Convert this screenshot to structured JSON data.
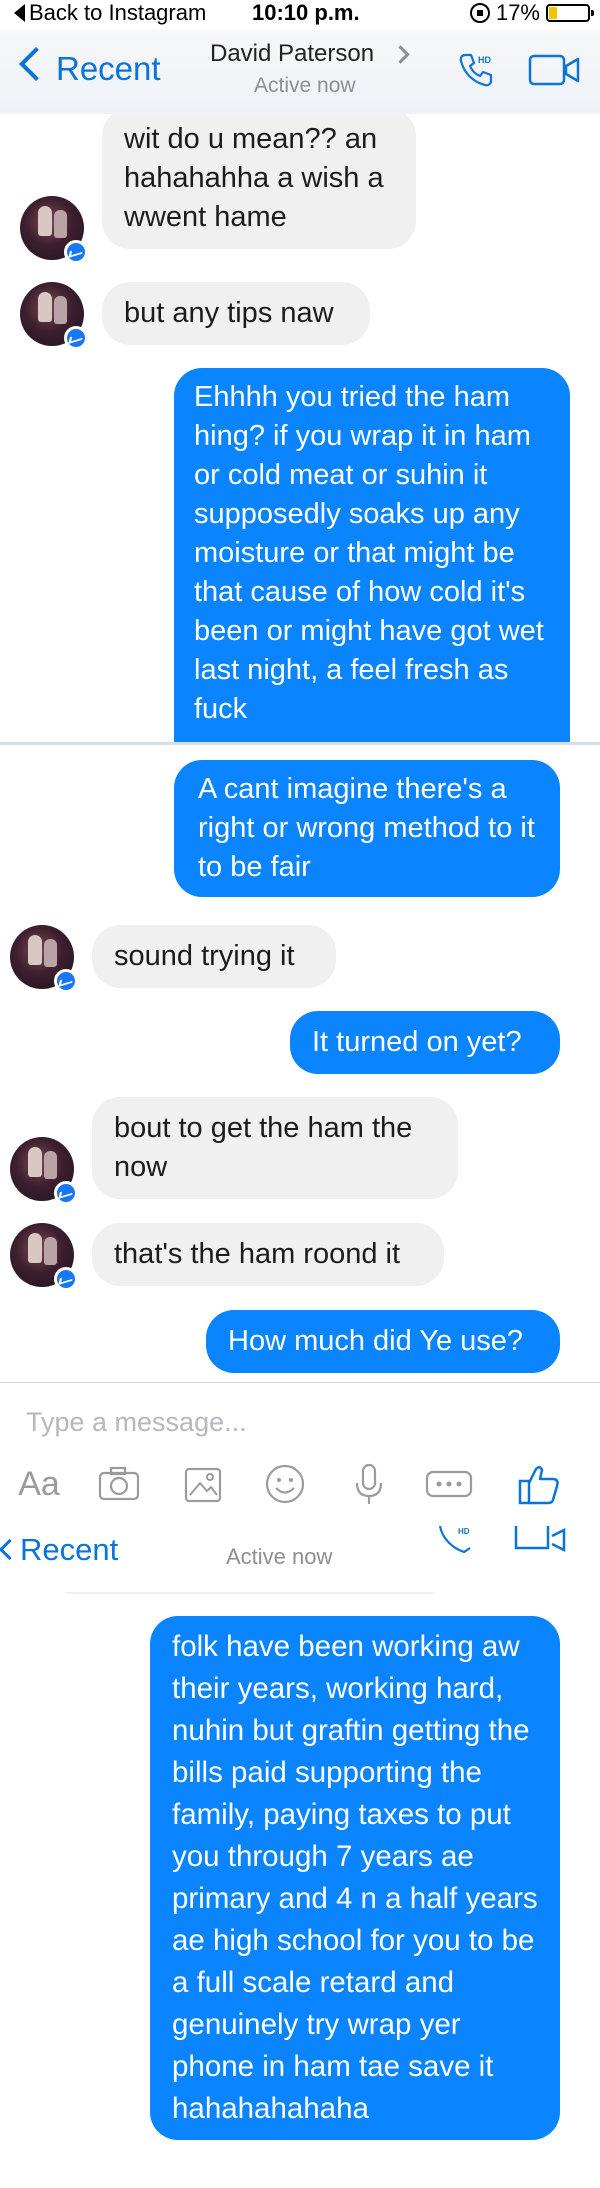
{
  "status_bar": {
    "back_label": "Back to Instagram",
    "time": "10:10 p.m.",
    "battery": "17%",
    "battery_level": 0.17
  },
  "nav": {
    "back_label": "Recent",
    "contact_name": "David Paterson",
    "status": "Active now"
  },
  "messages": [
    {
      "from": "them",
      "text": "wit do u mean?? an hahahahha a wish a wwent hame"
    },
    {
      "from": "them",
      "text": "but any tips naw"
    },
    {
      "from": "me",
      "text": "Ehhhh you tried the ham hing? if you wrap it in ham or cold meat or suhin it supposedly soaks up any moisture or that might be that cause of how cold it's been or might have got wet last night, a feel fresh as fuck"
    },
    {
      "from": "me",
      "text": "A cant imagine there's a right or wrong method to it to be fair"
    },
    {
      "from": "them",
      "text": "sound trying it"
    },
    {
      "from": "me",
      "text": "It turned on yet?"
    },
    {
      "from": "them",
      "text": "bout to get the ham the now"
    },
    {
      "from": "them",
      "text": "that's the ham roond it"
    },
    {
      "from": "me",
      "text": "How much did Ye use?"
    },
    {
      "from": "me",
      "text": "folk have been working aw their years, working hard, nuhin but graftin getting the bills paid supporting the family, paying taxes to put you through 7 years ae primary and 4 n a half years ae high school for you to be a full scale retard and genuinely try wrap yer phone in ham tae save it hahahahahaha"
    }
  ],
  "composer": {
    "placeholder": "Type a message...",
    "aa_label": "Aa",
    "tools": [
      "camera-icon",
      "gallery-icon",
      "emoji-icon",
      "microphone-icon",
      "more-icon",
      "thumbs-up-icon"
    ]
  },
  "lower_nav": {
    "back_label": "Recent",
    "status": "Active now"
  },
  "colors": {
    "accent": "#0a74d8",
    "outgoing_bubble": "#0a84ff",
    "incoming_bubble": "#f0f0f0"
  }
}
